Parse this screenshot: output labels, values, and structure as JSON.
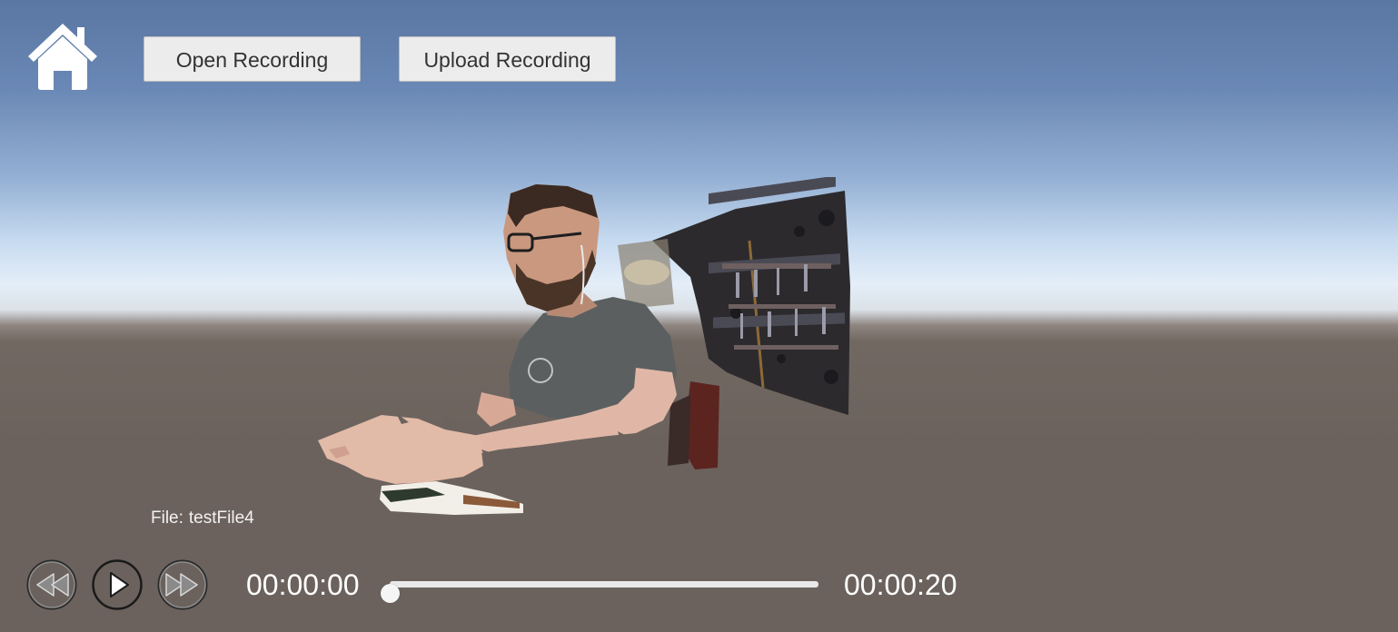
{
  "toolbar": {
    "home_icon": "home-icon",
    "open_recording_label": "Open Recording",
    "upload_recording_label": "Upload Recording"
  },
  "file": {
    "prefix": "File:",
    "name": "testFile4"
  },
  "playback": {
    "rewind_icon": "rewind-icon",
    "play_icon": "play-icon",
    "forward_icon": "fast-forward-icon",
    "current_time": "00:00:00",
    "total_time": "00:00:20",
    "progress": 0
  },
  "colors": {
    "sky_top": "#5a76a3",
    "horizon": "#e4eef8",
    "ground": "#6b625d",
    "button_bg": "#ececec",
    "text_white": "#ffffff"
  }
}
